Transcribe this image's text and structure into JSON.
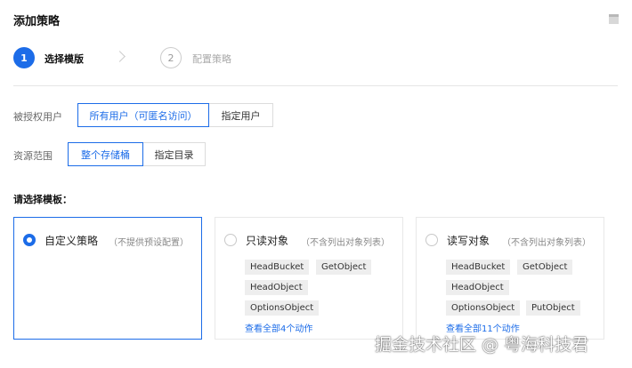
{
  "header": {
    "title": "添加策略",
    "corner_icon": "layout-icon"
  },
  "steps": [
    {
      "number": "1",
      "label": "选择模版"
    },
    {
      "number": "2",
      "label": "配置策略"
    }
  ],
  "form": {
    "authorized_users": {
      "label": "被授权用户",
      "options": [
        "所有用户（可匿名访问）",
        "指定用户"
      ],
      "selected": "所有用户（可匿名访问）"
    },
    "resource_scope": {
      "label": "资源范围",
      "options": [
        "整个存储桶",
        "指定目录"
      ],
      "selected": "整个存储桶"
    }
  },
  "templates": {
    "label": "请选择模板：",
    "cards": [
      {
        "title": "自定义策略",
        "note": "（不提供预设配置）",
        "selected": true,
        "actions": [],
        "more": ""
      },
      {
        "title": "只读对象",
        "note": "（不含列出对象列表）",
        "selected": false,
        "actions": [
          "HeadBucket",
          "GetObject",
          "HeadObject",
          "OptionsObject"
        ],
        "more": "查看全部4个动作"
      },
      {
        "title": "读写对象",
        "note": "（不含列出对象列表）",
        "selected": false,
        "actions": [
          "HeadBucket",
          "GetObject",
          "HeadObject",
          "OptionsObject",
          "PutObject"
        ],
        "more": "查看全部11个动作"
      }
    ]
  },
  "watermark": "掘金技术社区 @ 粤海科技君",
  "colors": {
    "accent": "#1c6ce8",
    "border": "#dcdcdc",
    "tag_bg": "#eeeeee"
  }
}
